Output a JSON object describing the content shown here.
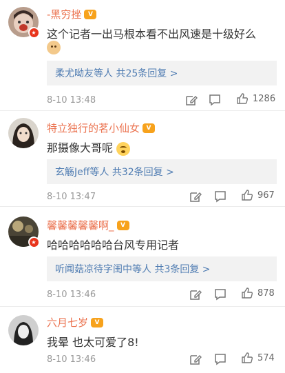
{
  "comments": [
    {
      "username": "-黑穷挫",
      "vip": "V",
      "text": "这个记者一出马根本看不出风速是十级好么",
      "emoji": "doge-icon",
      "replies": "柔尤呦友等人  共25条回复 >",
      "time": "8-10 13:48",
      "likes": "1286"
    },
    {
      "username": "特立独行的茗小仙女",
      "vip": "V",
      "text": "那摄像大哥呢",
      "emoji": "thinking-face-icon",
      "replies": "玄觞Jeff等人  共32条回复 >",
      "time": "8-10 13:47",
      "likes": "967"
    },
    {
      "username": "馨馨馨馨馨啊_",
      "vip": "V",
      "text": "哈哈哈哈哈哈台风专用记者",
      "replies": "听闻菇凉待字闺中等人  共3条回复 >",
      "time": "8-10 13:46",
      "likes": "878"
    },
    {
      "username": "六月七岁",
      "vip": "V",
      "text": "我晕 也太可爱了8!",
      "time": "8-10 13:46",
      "likes": "574"
    }
  ],
  "colors": {
    "username": "#eb7350",
    "reply_link": "#4f7cb2",
    "verified_badge": "#e8341c",
    "vip_badge": "#f7a21c"
  }
}
